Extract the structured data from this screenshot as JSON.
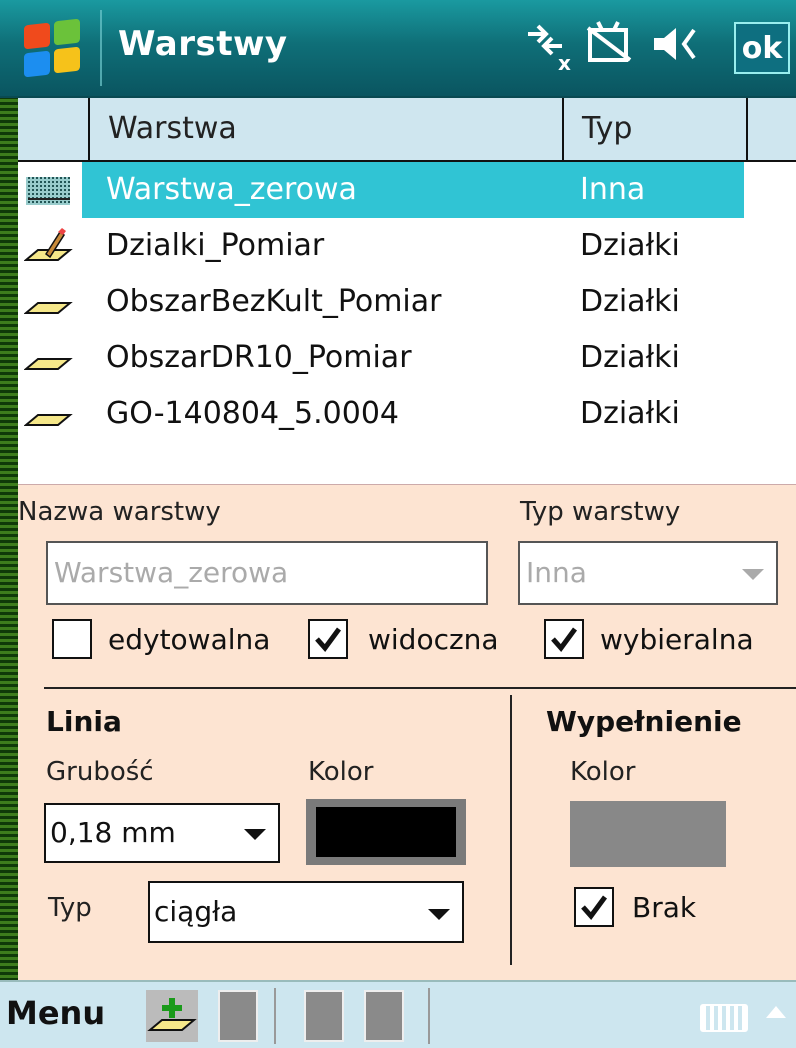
{
  "titlebar": {
    "title": "Warstwy",
    "ok_label": "ok"
  },
  "list": {
    "columns": [
      "Warstwa",
      "Typ"
    ],
    "rows": [
      {
        "name": "Warstwa_zerowa",
        "type": "Inna",
        "icon": "layer-grid-icon",
        "selected": true
      },
      {
        "name": "Dzialki_Pomiar",
        "type": "Działki",
        "icon": "edit-layer-icon"
      },
      {
        "name": "ObszarBezKult_Pomiar",
        "type": "Działki",
        "icon": "parallelogram-icon"
      },
      {
        "name": "ObszarDR10_Pomiar",
        "type": "Działki",
        "icon": "parallelogram-icon"
      },
      {
        "name": "GO-140804_5.0004",
        "type": "Działki",
        "icon": "parallelogram-icon"
      }
    ]
  },
  "details": {
    "name_label": "Nazwa warstwy",
    "name_value": "Warstwa_zerowa",
    "type_label": "Typ warstwy",
    "type_value": "Inna",
    "checkboxes": [
      {
        "label": "edytowalna",
        "checked": false
      },
      {
        "label": "widoczna",
        "checked": true
      },
      {
        "label": "wybieralna",
        "checked": true
      }
    ],
    "line": {
      "heading": "Linia",
      "thickness_label": "Grubość",
      "thickness_value": "0,18 mm",
      "color_label": "Kolor",
      "color": "#000000",
      "type_label": "Typ",
      "type_value": "ciągła"
    },
    "fill": {
      "heading": "Wypełnienie",
      "color_label": "Kolor",
      "color": "#888888",
      "none_label": "Brak",
      "none_checked": true
    }
  },
  "menubar": {
    "menu_label": "Menu"
  },
  "colors": {
    "titlebar": "#0f6f78",
    "selection": "#30c4d4",
    "panel": "#fde4d2",
    "header": "#cfe6ef"
  }
}
